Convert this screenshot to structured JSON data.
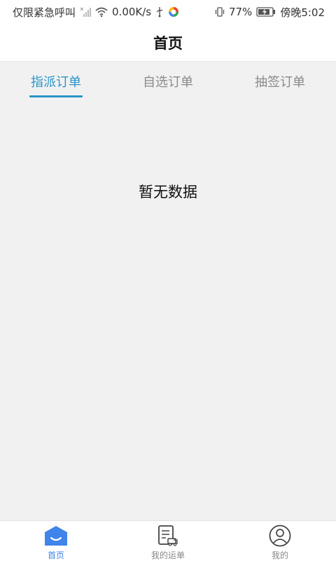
{
  "status_bar": {
    "carrier": "仅限紧急呼叫",
    "speed": "0.00K/s",
    "battery": "77%",
    "time": "傍晚5:02"
  },
  "header": {
    "title": "首页"
  },
  "tabs": [
    {
      "label": "指派订单",
      "active": true
    },
    {
      "label": "自选订单",
      "active": false
    },
    {
      "label": "抽签订单",
      "active": false
    }
  ],
  "content": {
    "empty_text": "暂无数据"
  },
  "bottom_nav": [
    {
      "label": "首页",
      "icon": "home-icon",
      "active": true
    },
    {
      "label": "我的运单",
      "icon": "waybill-icon",
      "active": false
    },
    {
      "label": "我的",
      "icon": "profile-icon",
      "active": false
    }
  ],
  "colors": {
    "accent": "#2a94c8",
    "nav_active": "#3f84e8",
    "background": "#f1f1f1"
  }
}
